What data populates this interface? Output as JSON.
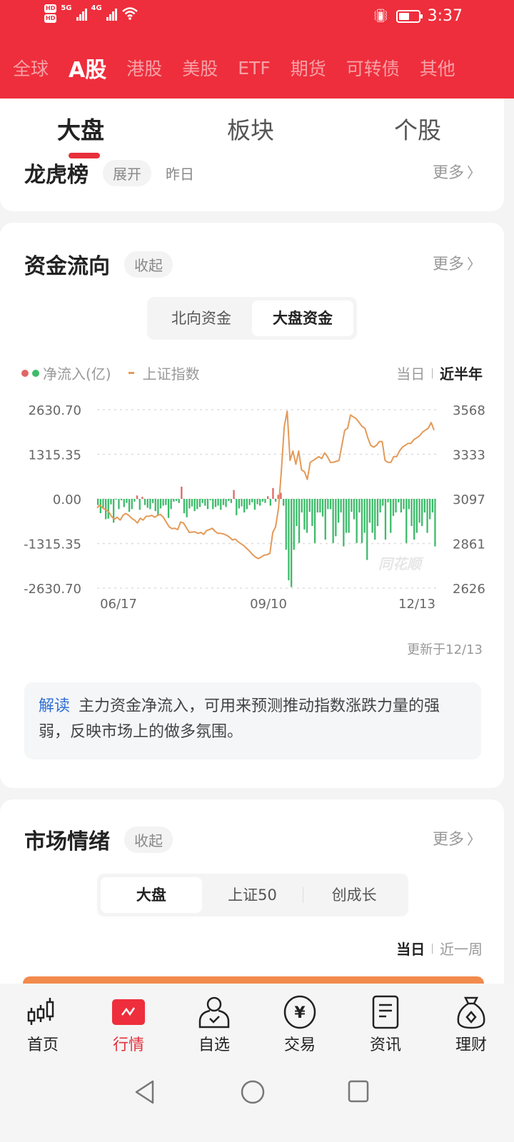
{
  "status_bar": {
    "sim1": "HD",
    "sim2": "HD",
    "net1": "5G",
    "net2": "4G",
    "time": "3:37"
  },
  "market_tabs": [
    {
      "label": "全球",
      "active": false
    },
    {
      "label": "A股",
      "active": true
    },
    {
      "label": "港股",
      "active": false
    },
    {
      "label": "美股",
      "active": false
    },
    {
      "label": "ETF",
      "active": false
    },
    {
      "label": "期货",
      "active": false
    },
    {
      "label": "可转债",
      "active": false
    },
    {
      "label": "其他",
      "active": false
    }
  ],
  "sub_tabs": [
    {
      "label": "大盘",
      "active": true
    },
    {
      "label": "板块",
      "active": false
    },
    {
      "label": "个股",
      "active": false
    }
  ],
  "longhu": {
    "title": "龙虎榜",
    "expand": "展开",
    "date": "昨日",
    "more": "更多"
  },
  "fund_flow": {
    "title": "资金流向",
    "collapse": "收起",
    "more": "更多",
    "segments": [
      {
        "label": "北向资金",
        "active": false
      },
      {
        "label": "大盘资金",
        "active": true
      }
    ],
    "legend_bar": "净流入(亿)",
    "legend_line": "上证指数",
    "range_options": [
      {
        "label": "当日",
        "active": false
      },
      {
        "label": "近半年",
        "active": true
      }
    ],
    "updated": "更新于12/13",
    "explain_tag": "解读",
    "explain_text": "主力资金净流入，可用来预测推动指数涨跌力量的强弱，反映市场上的做多氛围。",
    "watermark": "同花顺"
  },
  "market_sentiment": {
    "title": "市场情绪",
    "collapse": "收起",
    "more": "更多",
    "segments": [
      {
        "label": "大盘",
        "active": true
      },
      {
        "label": "上证50",
        "active": false
      },
      {
        "label": "创成长",
        "active": false
      }
    ],
    "range_options": [
      {
        "label": "当日",
        "active": true
      },
      {
        "label": "近一周",
        "active": false
      }
    ]
  },
  "bottom_nav": [
    {
      "label": "首页",
      "icon": "candlestick-icon",
      "active": false
    },
    {
      "label": "行情",
      "icon": "market-chart-icon",
      "active": true
    },
    {
      "label": "自选",
      "icon": "user-check-icon",
      "active": false
    },
    {
      "label": "交易",
      "icon": "yen-coin-icon",
      "active": false
    },
    {
      "label": "资讯",
      "icon": "document-icon",
      "active": false
    },
    {
      "label": "理财",
      "icon": "money-bag-icon",
      "active": false
    }
  ],
  "colors": {
    "brand_red": "#ee2e3c",
    "inflow_red": "#e06666",
    "outflow_green": "#3dbb6a",
    "index_line": "#e39a58",
    "link_blue": "#2f6fd6"
  },
  "chart_data": {
    "type": "bar+line",
    "title": "资金流向 - 大盘资金 近半年",
    "x_tick_labels": [
      "06/17",
      "09/10",
      "12/13"
    ],
    "y_left_label": "净流入(亿)",
    "y_left_ticks": [
      "2630.70",
      "1315.35",
      "0.00",
      "-1315.35",
      "-2630.70"
    ],
    "y_left_range": [
      -2630.7,
      2630.7
    ],
    "y_right_label": "上证指数",
    "y_right_ticks": [
      "3568",
      "3333",
      "3097",
      "2861",
      "2626"
    ],
    "y_right_range": [
      2626,
      3568
    ],
    "grid": true,
    "legend_position": "top-left",
    "series": [
      {
        "name": "净流入(亿)",
        "type": "bar",
        "values": [
          -180,
          -420,
          -260,
          -600,
          -580,
          -160,
          -700,
          -20,
          -300,
          -40,
          -240,
          -120,
          -380,
          -300,
          -80,
          100,
          -320,
          60,
          -180,
          -260,
          -300,
          -120,
          -360,
          -480,
          -280,
          -200,
          -180,
          -560,
          -300,
          -80,
          -60,
          -120,
          360,
          -420,
          -540,
          -280,
          -220,
          -360,
          -300,
          -240,
          -120,
          -200,
          -300,
          -40,
          -300,
          -240,
          -200,
          -320,
          -180,
          -240,
          -60,
          -120,
          260,
          -480,
          -280,
          -220,
          -400,
          -300,
          -180,
          -100,
          -320,
          -160,
          -200,
          -80,
          -120,
          80,
          -200,
          320,
          -80,
          120,
          180,
          -200,
          -1500,
          -2400,
          -2600,
          -1500,
          -800,
          -1300,
          -400,
          -900,
          -1000,
          -380,
          -800,
          -1300,
          -400,
          -400,
          -520,
          -1200,
          -300,
          -300,
          -1300,
          -1100,
          -700,
          -400,
          -1400,
          -1000,
          -1000,
          -380,
          -600,
          -1300,
          -400,
          -1300,
          -1000,
          -1800,
          -700,
          -1000,
          -1200,
          -800,
          -400,
          -200,
          -1200,
          -100,
          -1000,
          -500,
          -400,
          -100,
          -400,
          -300,
          -1300,
          -300,
          -800,
          -1200,
          -1000,
          -700,
          -800,
          -400,
          -1000,
          -600,
          -400,
          -1400
        ],
        "colors_by_sign": {
          "positive": "#e06666",
          "negative": "#3dbb6a"
        }
      },
      {
        "name": "上证指数",
        "type": "line",
        "values": [
          3050,
          3065,
          3048,
          3040,
          3030,
          3005,
          2990,
          3000,
          2985,
          3010,
          3020,
          3010,
          2995,
          2985,
          2970,
          2995,
          2985,
          3005,
          3005,
          3010,
          3000,
          3010,
          3015,
          3000,
          2975,
          2950,
          2940,
          2942,
          2935,
          2975,
          2970,
          2945,
          2920,
          2922,
          2923,
          2915,
          2920,
          2910,
          2930,
          2935,
          2942,
          2925,
          2915,
          2915,
          2912,
          2905,
          2895,
          2880,
          2885,
          2870,
          2860,
          2850,
          2835,
          2820,
          2803,
          2790,
          2782,
          2790,
          2800,
          2802,
          2810,
          2920,
          2950,
          3050,
          3250,
          3480,
          3560,
          3300,
          3350,
          3280,
          3350,
          3250,
          3240,
          3200,
          3290,
          3300,
          3310,
          3320,
          3310,
          3340,
          3320,
          3290,
          3290,
          3295,
          3300,
          3380,
          3460,
          3470,
          3540,
          3530,
          3520,
          3500,
          3480,
          3470,
          3420,
          3380,
          3370,
          3380,
          3400,
          3400,
          3300,
          3290,
          3290,
          3320,
          3320,
          3350,
          3370,
          3380,
          3390,
          3390,
          3410,
          3420,
          3430,
          3450,
          3460,
          3470,
          3500,
          3460
        ],
        "color": "#e39a58"
      }
    ]
  }
}
